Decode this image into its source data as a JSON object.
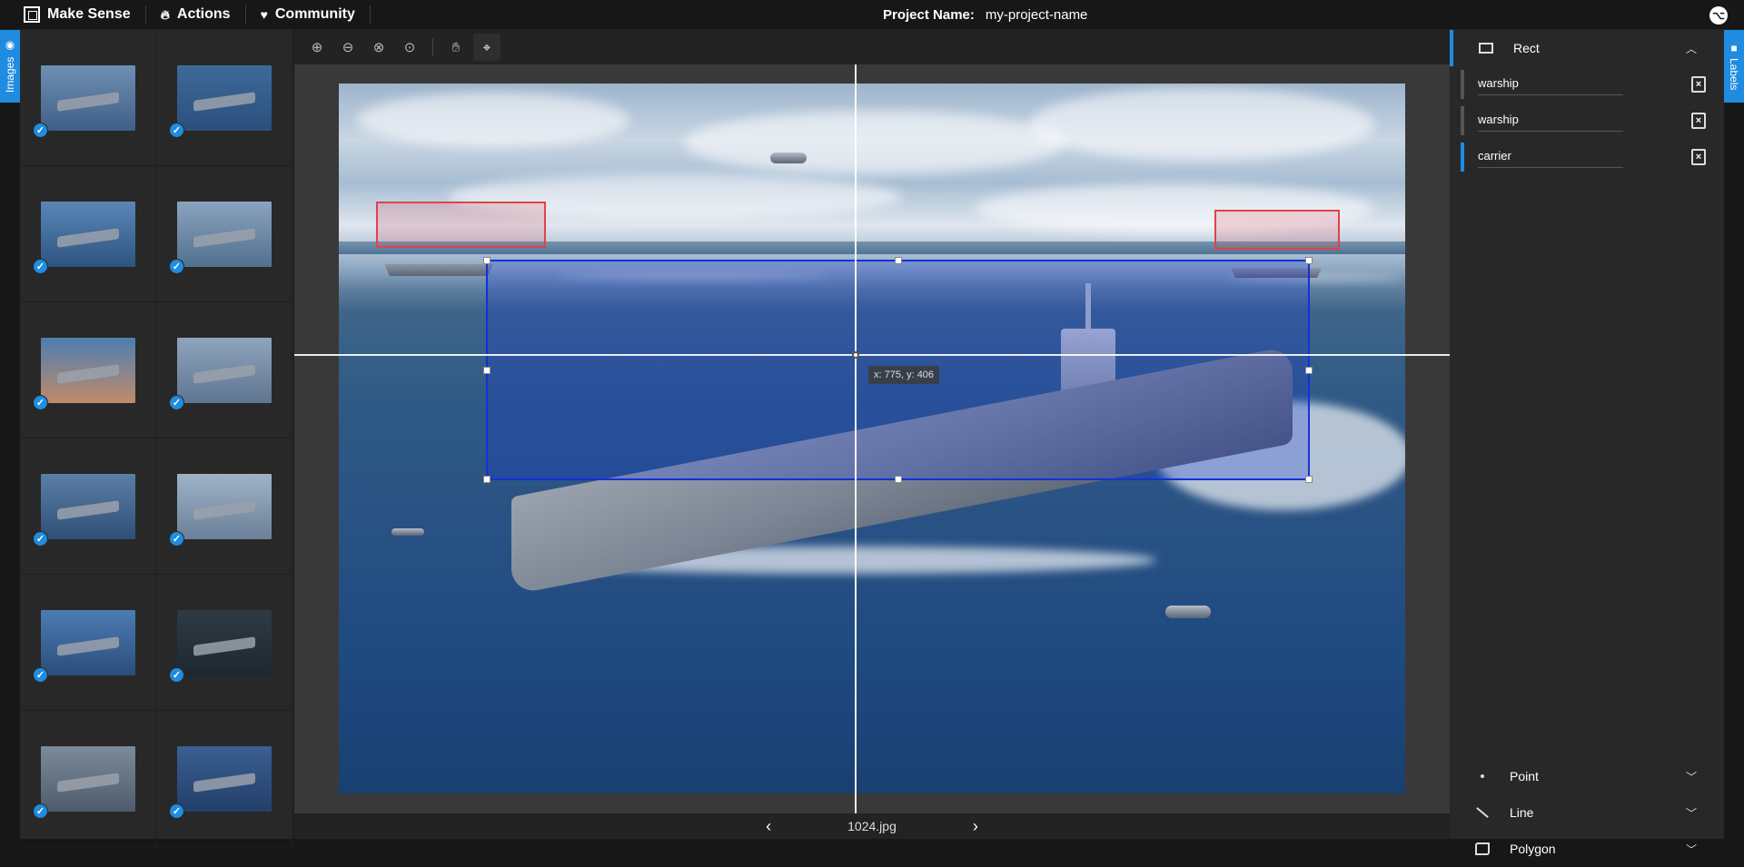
{
  "header": {
    "brand": "Make Sense",
    "nav": [
      {
        "label": "Actions",
        "icon": "flame-icon"
      },
      {
        "label": "Community",
        "icon": "heart-icon"
      }
    ],
    "project_label": "Project Name:",
    "project_name": "my-project-name",
    "github_icon": "github-icon"
  },
  "side_tabs": {
    "left": "Images",
    "right": "Labels"
  },
  "images": {
    "thumbnails": [
      {
        "checked": true
      },
      {
        "checked": true
      },
      {
        "checked": true
      },
      {
        "checked": true
      },
      {
        "checked": true
      },
      {
        "checked": true
      },
      {
        "checked": true
      },
      {
        "checked": true
      },
      {
        "checked": true
      },
      {
        "checked": true
      },
      {
        "checked": true
      },
      {
        "checked": true
      }
    ]
  },
  "toolbar": {
    "tools": [
      "zoom-in-icon",
      "zoom-out-icon",
      "zoom-fit-icon",
      "zoom-max-icon",
      "pan-hand-icon",
      "crosshair-icon"
    ]
  },
  "editor": {
    "cursor_readout": "x: 775, y: 406",
    "current_file": "1024.jpg",
    "prev_label": "‹",
    "next_label": "›"
  },
  "labels_panel": {
    "active_tool": "Rect",
    "items": [
      {
        "name": "warship",
        "active": false
      },
      {
        "name": "warship",
        "active": false
      },
      {
        "name": "carrier",
        "active": true
      }
    ],
    "other_tools": [
      "Point",
      "Line",
      "Polygon"
    ]
  },
  "colors": {
    "accent": "#1f8ce0",
    "box_red": "#e0434b",
    "box_blue": "#1232d6"
  }
}
